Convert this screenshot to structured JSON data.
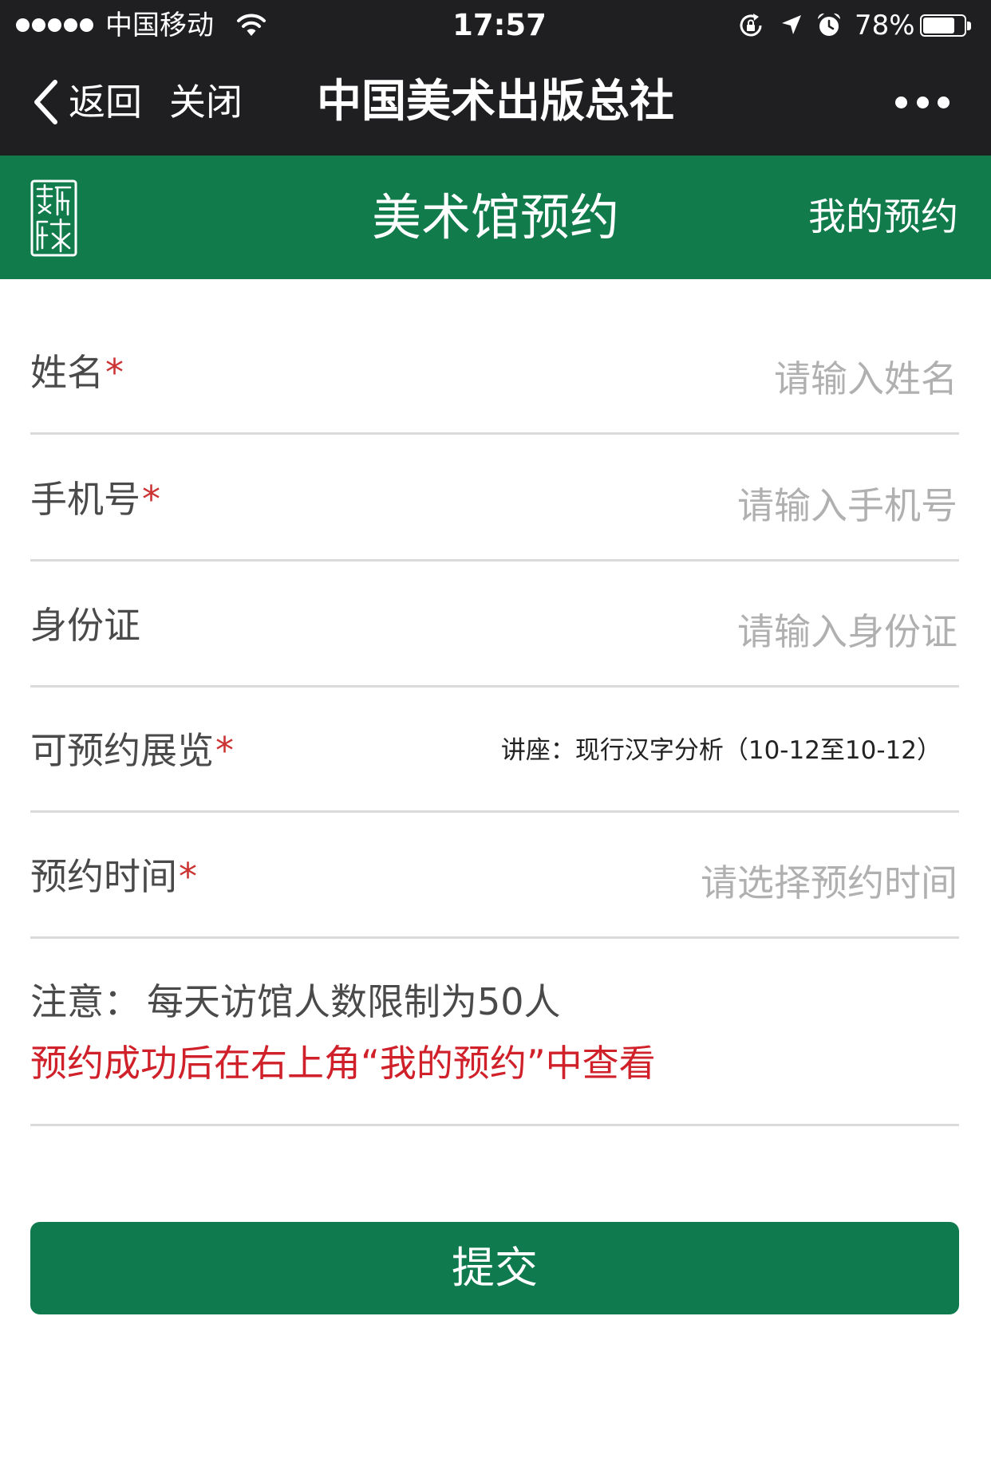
{
  "status_bar": {
    "signal_strength": 5,
    "carrier": "中国移动",
    "time": "17:57",
    "battery_text": "78%",
    "battery_level": 0.78,
    "icons": {
      "signal": "signal-dots-icon",
      "wifi": "wifi-icon",
      "rotation_lock": "rotation-lock-icon",
      "location": "location-arrow-icon",
      "alarm": "alarm-clock-icon",
      "battery": "battery-icon"
    }
  },
  "nav_bar": {
    "back_icon": "chevron-left-icon",
    "back_label": "返回",
    "close_label": "关闭",
    "title": "中国美术出版总社",
    "more_icon": "more-dots-icon"
  },
  "header": {
    "logo_icon": "seal-logo-icon",
    "title": "美术馆预约",
    "my_bookings_label": "我的预约"
  },
  "form": {
    "required_mark": "*",
    "fields": [
      {
        "label": "姓名",
        "required": true,
        "placeholder": "请输入姓名"
      },
      {
        "label": "手机号",
        "required": true,
        "placeholder": "请输入手机号"
      },
      {
        "label": "身份证",
        "required": false,
        "placeholder": "请输入身份证"
      },
      {
        "label": "可预约展览",
        "required": true,
        "selected_value": "讲座：现行汉字分析（10-12至10-12）"
      },
      {
        "label": "预约时间",
        "required": true,
        "placeholder": "请选择预约时间"
      }
    ]
  },
  "notice": {
    "label": "注意：",
    "text": "每天访馆人数限制为50人",
    "highlight": "预约成功后在右上角“我的预约”中查看"
  },
  "submit_label": "提交",
  "colors": {
    "nav_background": "#1f1f22",
    "brand_green": "#117b4c",
    "button_green": "#0f7a4e",
    "required_red": "#cc3333",
    "notice_red": "#d0212b",
    "placeholder_gray": "#b0b0b0",
    "label_text": "#4a4a4a",
    "divider": "#dadada"
  }
}
